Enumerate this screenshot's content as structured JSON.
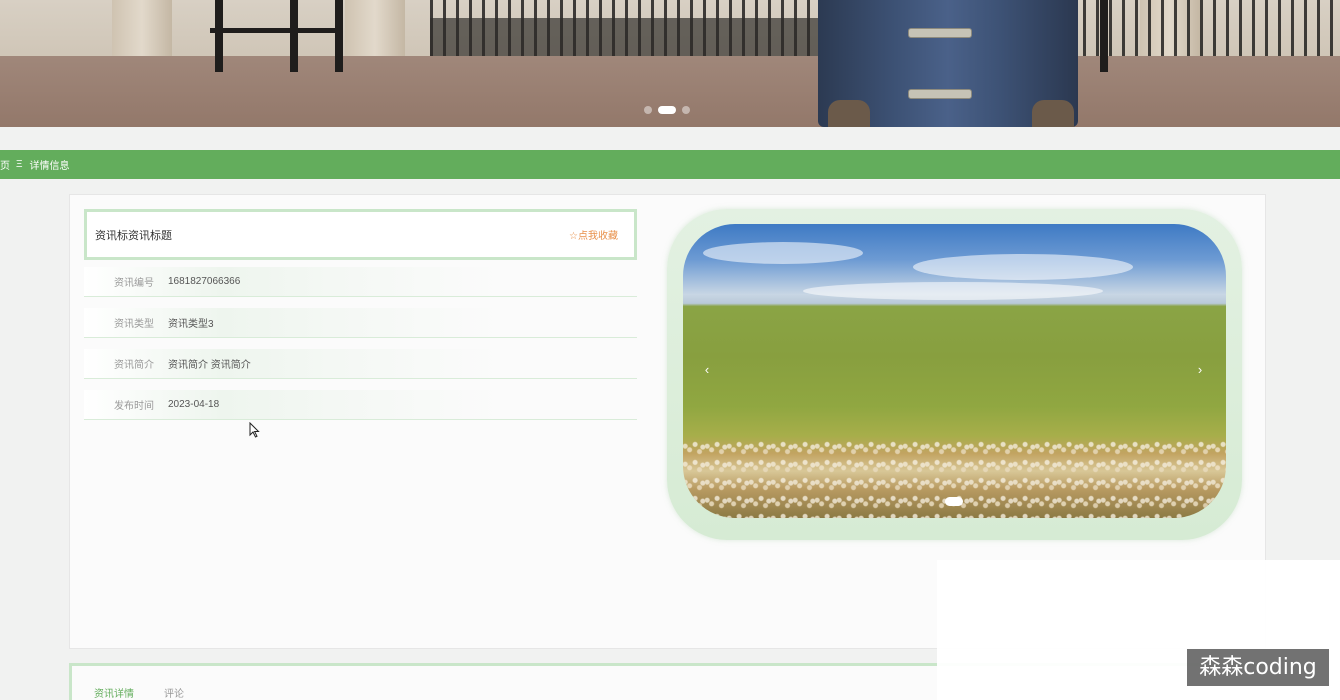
{
  "banner": {
    "dots": [
      false,
      true,
      false
    ]
  },
  "breadcrumb": {
    "home": "页",
    "separator": "Ξ",
    "current": "详情信息"
  },
  "detail": {
    "title": "资讯标资讯标题",
    "favorite_label": "☆点我收藏",
    "rows": [
      {
        "label": "资讯编号",
        "value": "1681827066366"
      },
      {
        "label": "资讯类型",
        "value": "资讯类型3"
      },
      {
        "label": "资讯简介",
        "value": "资讯简介 资讯简介"
      },
      {
        "label": "发布时间",
        "value": "2023-04-18"
      }
    ]
  },
  "carousel": {
    "prev_icon": "chevron-left-icon",
    "next_icon": "chevron-right-icon",
    "prev_glyph": "‹",
    "next_glyph": "›"
  },
  "tabs": [
    {
      "label": "资讯详情",
      "active": true
    },
    {
      "label": "评论",
      "active": false
    }
  ],
  "watermark": "森森coding",
  "colors": {
    "accent_green": "#63ad5c",
    "border_green": "#c9e6c9",
    "favorite_orange": "#e8904a"
  }
}
